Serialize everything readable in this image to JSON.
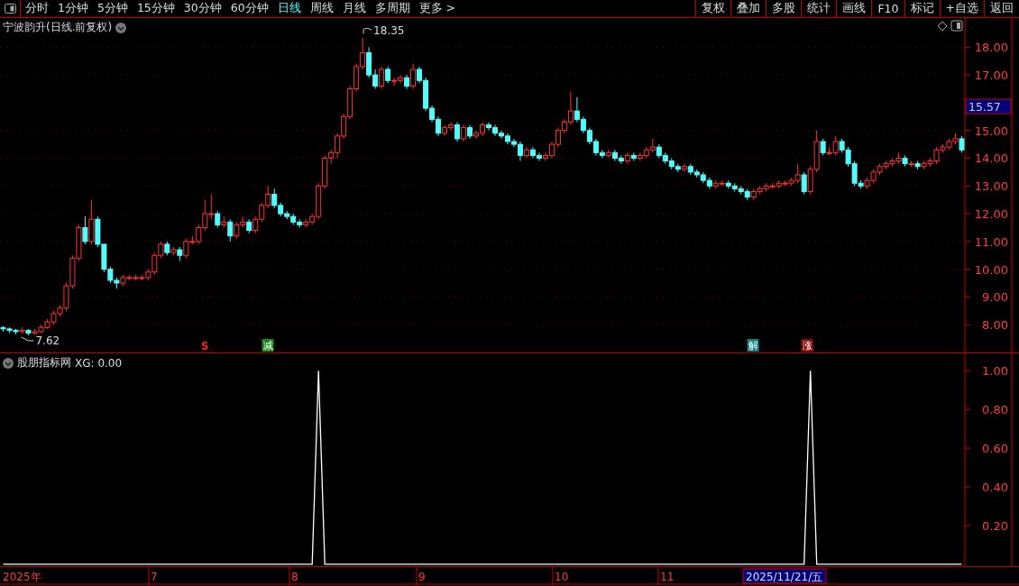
{
  "toolbar": {
    "periods": [
      {
        "label": "分时",
        "selected": false
      },
      {
        "label": "1分钟",
        "selected": false
      },
      {
        "label": "5分钟",
        "selected": false
      },
      {
        "label": "15分钟",
        "selected": false
      },
      {
        "label": "30分钟",
        "selected": false
      },
      {
        "label": "60分钟",
        "selected": false
      },
      {
        "label": "日线",
        "selected": true
      },
      {
        "label": "周线",
        "selected": false
      },
      {
        "label": "月线",
        "selected": false
      },
      {
        "label": "多周期",
        "selected": false
      },
      {
        "label": "更多 >",
        "selected": false
      }
    ],
    "buttons": [
      "复权",
      "叠加",
      "多股",
      "统计",
      "画线",
      "F10",
      "标记",
      "+自选",
      "返回"
    ]
  },
  "price_panel": {
    "title": "宁波韵升(日线.前复权)",
    "chart_data": {
      "type": "candlestick",
      "grid": true,
      "ylim": [
        7.0,
        19.05
      ],
      "yticks": [
        {
          "value": 8,
          "label": "8.00"
        },
        {
          "value": 9,
          "label": "9.00"
        },
        {
          "value": 10,
          "label": "10.00"
        },
        {
          "value": 11,
          "label": "11.00"
        },
        {
          "value": 12,
          "label": "12.00"
        },
        {
          "value": 13,
          "label": "13.00"
        },
        {
          "value": 14,
          "label": "14.00"
        },
        {
          "value": 15,
          "label": "15.00"
        },
        {
          "value": 17,
          "label": "17.00"
        },
        {
          "value": 18,
          "label": "18.00"
        }
      ],
      "ohlc": [
        [
          7.9,
          7.95,
          7.75,
          7.85
        ],
        [
          7.85,
          7.9,
          7.7,
          7.8
        ],
        [
          7.8,
          7.85,
          7.65,
          7.75
        ],
        [
          7.75,
          7.9,
          7.7,
          7.8
        ],
        [
          7.8,
          7.85,
          7.62,
          7.7
        ],
        [
          7.7,
          7.85,
          7.65,
          7.75
        ],
        [
          7.75,
          8.0,
          7.7,
          7.9
        ],
        [
          7.9,
          8.2,
          7.85,
          8.1
        ],
        [
          8.1,
          8.5,
          8.0,
          8.4
        ],
        [
          8.4,
          8.7,
          8.3,
          8.6
        ],
        [
          8.6,
          9.5,
          8.5,
          9.4
        ],
        [
          9.4,
          10.5,
          9.3,
          10.4
        ],
        [
          10.4,
          11.6,
          10.3,
          11.5
        ],
        [
          11.5,
          11.9,
          10.9,
          11.0
        ],
        [
          11.0,
          12.5,
          10.9,
          11.8
        ],
        [
          11.8,
          11.9,
          10.8,
          10.9
        ],
        [
          10.9,
          10.9,
          9.9,
          10.0
        ],
        [
          10.0,
          10.1,
          9.5,
          9.6
        ],
        [
          9.6,
          9.7,
          9.3,
          9.5
        ],
        [
          9.5,
          9.8,
          9.4,
          9.7
        ],
        [
          9.7,
          9.8,
          9.6,
          9.7
        ],
        [
          9.7,
          9.8,
          9.6,
          9.7
        ],
        [
          9.7,
          9.8,
          9.6,
          9.7
        ],
        [
          9.7,
          10.0,
          9.6,
          9.9
        ],
        [
          9.9,
          10.6,
          9.8,
          10.5
        ],
        [
          10.5,
          11.0,
          10.4,
          10.9
        ],
        [
          10.9,
          11.0,
          10.5,
          10.6
        ],
        [
          10.6,
          10.8,
          10.5,
          10.7
        ],
        [
          10.7,
          10.8,
          10.3,
          10.5
        ],
        [
          10.5,
          11.1,
          10.4,
          11.0
        ],
        [
          11.0,
          11.2,
          10.9,
          11.0
        ],
        [
          11.0,
          11.6,
          10.9,
          11.5
        ],
        [
          11.5,
          12.5,
          11.4,
          12.0
        ],
        [
          12.0,
          12.7,
          11.8,
          12.0
        ],
        [
          12.0,
          12.1,
          11.5,
          11.6
        ],
        [
          11.6,
          11.9,
          11.5,
          11.7
        ],
        [
          11.7,
          11.8,
          11.0,
          11.2
        ],
        [
          11.2,
          11.7,
          11.1,
          11.6
        ],
        [
          11.6,
          11.9,
          11.5,
          11.7
        ],
        [
          11.7,
          11.8,
          11.3,
          11.4
        ],
        [
          11.4,
          11.9,
          11.3,
          11.8
        ],
        [
          11.8,
          12.4,
          11.7,
          12.3
        ],
        [
          12.3,
          13.0,
          12.2,
          12.7
        ],
        [
          12.7,
          12.9,
          12.2,
          12.3
        ],
        [
          12.3,
          12.4,
          11.9,
          12.0
        ],
        [
          12.0,
          12.1,
          11.8,
          11.9
        ],
        [
          11.9,
          12.0,
          11.6,
          11.7
        ],
        [
          11.7,
          11.8,
          11.5,
          11.6
        ],
        [
          11.6,
          11.8,
          11.5,
          11.7
        ],
        [
          11.7,
          12.0,
          11.6,
          11.9
        ],
        [
          11.9,
          13.1,
          11.8,
          13.0
        ],
        [
          13.0,
          14.1,
          12.9,
          14.0
        ],
        [
          14.0,
          14.3,
          13.8,
          14.2
        ],
        [
          14.2,
          14.9,
          14.0,
          14.8
        ],
        [
          14.8,
          15.6,
          14.7,
          15.5
        ],
        [
          15.5,
          16.6,
          15.4,
          16.5
        ],
        [
          16.5,
          17.4,
          16.4,
          17.3
        ],
        [
          17.3,
          18.35,
          17.2,
          17.8
        ],
        [
          17.8,
          18.0,
          16.9,
          17.0
        ],
        [
          17.0,
          17.2,
          16.5,
          16.6
        ],
        [
          16.6,
          17.3,
          16.5,
          17.2
        ],
        [
          17.2,
          17.3,
          16.7,
          16.8
        ],
        [
          16.8,
          16.9,
          16.6,
          16.8
        ],
        [
          16.8,
          17.0,
          16.7,
          16.9
        ],
        [
          16.9,
          17.0,
          16.5,
          16.6
        ],
        [
          16.6,
          17.4,
          16.5,
          17.2
        ],
        [
          17.2,
          17.3,
          16.7,
          16.8
        ],
        [
          16.8,
          16.9,
          15.7,
          15.8
        ],
        [
          15.8,
          15.9,
          15.3,
          15.4
        ],
        [
          15.4,
          15.5,
          14.8,
          14.9
        ],
        [
          14.9,
          15.2,
          14.8,
          15.1
        ],
        [
          15.1,
          15.3,
          15.0,
          15.2
        ],
        [
          15.2,
          15.3,
          14.6,
          14.7
        ],
        [
          14.7,
          15.2,
          14.6,
          15.1
        ],
        [
          15.1,
          15.2,
          14.7,
          14.8
        ],
        [
          14.8,
          15.0,
          14.7,
          14.9
        ],
        [
          14.9,
          15.3,
          14.8,
          15.2
        ],
        [
          15.2,
          15.3,
          15.0,
          15.1
        ],
        [
          15.1,
          15.2,
          14.8,
          14.9
        ],
        [
          14.9,
          15.0,
          14.7,
          14.8
        ],
        [
          14.8,
          14.9,
          14.5,
          14.6
        ],
        [
          14.6,
          14.7,
          14.4,
          14.5
        ],
        [
          14.5,
          14.6,
          13.9,
          14.1
        ],
        [
          14.1,
          14.4,
          14.0,
          14.3
        ],
        [
          14.3,
          14.4,
          14.0,
          14.1
        ],
        [
          14.1,
          14.2,
          13.9,
          14.0
        ],
        [
          14.0,
          14.2,
          13.9,
          14.1
        ],
        [
          14.1,
          14.6,
          14.0,
          14.5
        ],
        [
          14.5,
          15.1,
          14.4,
          15.0
        ],
        [
          15.0,
          15.4,
          14.9,
          15.3
        ],
        [
          15.3,
          16.4,
          15.2,
          15.7
        ],
        [
          15.7,
          16.2,
          15.3,
          15.4
        ],
        [
          15.4,
          15.5,
          14.9,
          15.0
        ],
        [
          15.0,
          15.1,
          14.5,
          14.6
        ],
        [
          14.6,
          14.7,
          14.1,
          14.2
        ],
        [
          14.2,
          14.3,
          14.0,
          14.1
        ],
        [
          14.1,
          14.3,
          14.0,
          14.2
        ],
        [
          14.2,
          14.3,
          13.9,
          14.0
        ],
        [
          14.0,
          14.1,
          13.8,
          13.9
        ],
        [
          13.9,
          14.2,
          13.8,
          14.1
        ],
        [
          14.1,
          14.2,
          13.9,
          14.0
        ],
        [
          14.0,
          14.2,
          13.9,
          14.1
        ],
        [
          14.1,
          14.4,
          14.0,
          14.3
        ],
        [
          14.3,
          14.7,
          14.2,
          14.4
        ],
        [
          14.4,
          14.5,
          14.0,
          14.1
        ],
        [
          14.1,
          14.2,
          13.8,
          13.9
        ],
        [
          13.9,
          14.0,
          13.6,
          13.7
        ],
        [
          13.7,
          13.8,
          13.5,
          13.6
        ],
        [
          13.6,
          13.8,
          13.5,
          13.7
        ],
        [
          13.7,
          13.8,
          13.4,
          13.5
        ],
        [
          13.5,
          13.6,
          13.3,
          13.4
        ],
        [
          13.4,
          13.5,
          13.1,
          13.2
        ],
        [
          13.2,
          13.3,
          12.9,
          13.0
        ],
        [
          13.0,
          13.2,
          12.9,
          13.1
        ],
        [
          13.1,
          13.2,
          13.0,
          13.1
        ],
        [
          13.1,
          13.2,
          12.9,
          13.0
        ],
        [
          13.0,
          13.1,
          12.8,
          12.9
        ],
        [
          12.9,
          13.0,
          12.7,
          12.8
        ],
        [
          12.8,
          12.9,
          12.5,
          12.6
        ],
        [
          12.6,
          12.9,
          12.5,
          12.8
        ],
        [
          12.8,
          13.0,
          12.7,
          12.9
        ],
        [
          12.9,
          13.1,
          12.8,
          13.0
        ],
        [
          13.0,
          13.1,
          12.9,
          13.0
        ],
        [
          13.0,
          13.2,
          12.9,
          13.1
        ],
        [
          13.1,
          13.2,
          13.0,
          13.1
        ],
        [
          13.1,
          13.3,
          13.0,
          13.2
        ],
        [
          13.2,
          13.8,
          13.1,
          13.4
        ],
        [
          13.4,
          13.5,
          12.7,
          12.8
        ],
        [
          12.8,
          13.7,
          12.7,
          13.6
        ],
        [
          13.6,
          15.0,
          13.5,
          14.6
        ],
        [
          14.6,
          14.7,
          14.1,
          14.2
        ],
        [
          14.2,
          14.4,
          14.1,
          14.2
        ],
        [
          14.2,
          14.8,
          14.1,
          14.6
        ],
        [
          14.6,
          14.7,
          14.2,
          14.3
        ],
        [
          14.3,
          14.4,
          13.7,
          13.8
        ],
        [
          13.8,
          13.9,
          13.0,
          13.1
        ],
        [
          13.1,
          13.2,
          12.9,
          13.0
        ],
        [
          13.0,
          13.3,
          12.9,
          13.2
        ],
        [
          13.2,
          13.6,
          13.1,
          13.5
        ],
        [
          13.5,
          13.8,
          13.4,
          13.7
        ],
        [
          13.7,
          13.9,
          13.6,
          13.8
        ],
        [
          13.8,
          14.0,
          13.7,
          13.9
        ],
        [
          13.9,
          14.2,
          13.8,
          14.0
        ],
        [
          14.0,
          14.1,
          13.7,
          13.8
        ],
        [
          13.8,
          13.9,
          13.7,
          13.8
        ],
        [
          13.8,
          13.9,
          13.6,
          13.7
        ],
        [
          13.7,
          13.9,
          13.6,
          13.8
        ],
        [
          13.8,
          14.0,
          13.7,
          13.9
        ],
        [
          13.9,
          14.4,
          13.8,
          14.3
        ],
        [
          14.3,
          14.5,
          14.2,
          14.4
        ],
        [
          14.4,
          14.7,
          14.3,
          14.6
        ],
        [
          14.6,
          14.9,
          14.5,
          14.7
        ],
        [
          14.7,
          14.8,
          14.2,
          14.3
        ]
      ],
      "annotations": [
        "18.35",
        "7.62"
      ]
    },
    "price_tag": "15.57",
    "signals": [
      {
        "text": "S",
        "kind": "mark",
        "color": "#ff2020"
      },
      {
        "text": "减",
        "kind": "badge",
        "color": "#1a8a1a"
      },
      {
        "text": "解",
        "kind": "badge",
        "color": "#108080"
      },
      {
        "text": "涨",
        "kind": "badge",
        "color": "#8a0a0a"
      }
    ]
  },
  "indicator_panel": {
    "title": "股朋指标网",
    "reading": "XG: 0.00",
    "chart_data": {
      "type": "line",
      "ylim": [
        -0.01,
        1.09
      ],
      "yticks": [
        {
          "value": 0.2,
          "label": "0.20"
        },
        {
          "value": 0.4,
          "label": "0.40"
        },
        {
          "value": 0.6,
          "label": "0.60"
        },
        {
          "value": 0.8,
          "label": "0.80"
        },
        {
          "value": 1.0,
          "label": "1.00"
        }
      ],
      "series": [
        {
          "color": "#ffffff",
          "values": [
            0,
            0,
            0,
            0,
            0,
            0,
            0,
            0,
            0,
            0,
            0,
            0,
            0,
            0,
            0,
            0,
            0,
            0,
            0,
            0,
            0,
            0,
            0,
            0,
            0,
            0,
            0,
            0,
            0,
            0,
            0,
            0,
            0,
            0,
            0,
            0,
            0,
            0,
            0,
            0,
            0,
            0,
            0,
            0,
            0,
            0,
            0,
            0,
            0,
            0,
            1,
            0,
            0,
            0,
            0,
            0,
            0,
            0,
            0,
            0,
            0,
            0,
            0,
            0,
            0,
            0,
            0,
            0,
            0,
            0,
            0,
            0,
            0,
            0,
            0,
            0,
            0,
            0,
            0,
            0,
            0,
            0,
            0,
            0,
            0,
            0,
            0,
            0,
            0,
            0,
            0,
            0,
            0,
            0,
            0,
            0,
            0,
            0,
            0,
            0,
            0,
            0,
            0,
            0,
            0,
            0,
            0,
            0,
            0,
            0,
            0,
            0,
            0,
            0,
            0,
            0,
            0,
            0,
            0,
            0,
            0,
            0,
            0,
            0,
            0,
            0,
            0,
            0,
            1,
            0,
            0,
            0,
            0,
            0,
            0,
            0,
            0,
            0,
            0,
            0,
            0,
            0,
            0,
            0,
            0,
            0,
            0,
            0,
            0,
            0,
            0,
            0,
            0
          ]
        }
      ]
    }
  },
  "date_axis": {
    "labels": [
      "2025年",
      "7",
      "8",
      "9",
      "10",
      "11"
    ],
    "cursor": "2025/11/21/五"
  }
}
